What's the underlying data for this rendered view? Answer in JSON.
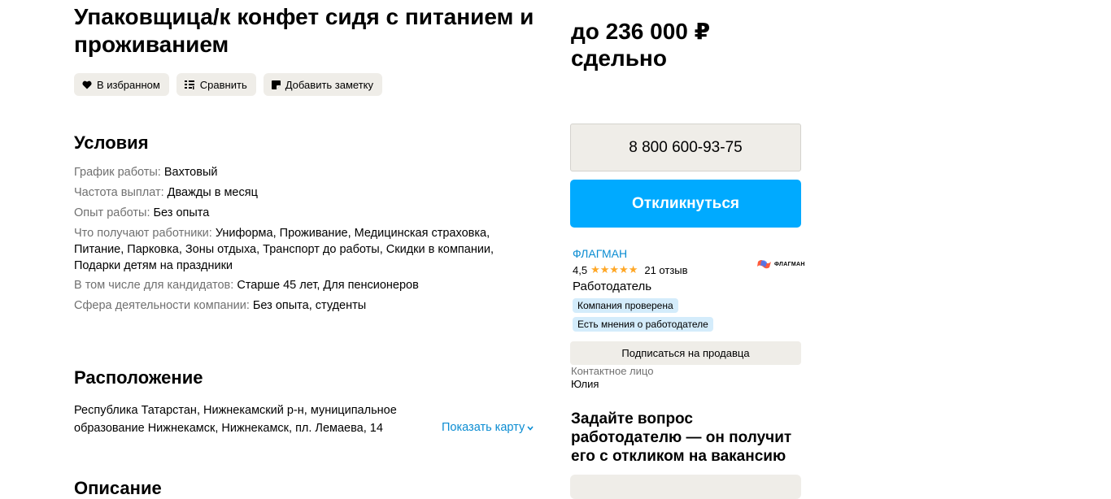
{
  "vacancy": {
    "title": "Упаковщица/к конфет сидя с питанием и проживанием",
    "actions": {
      "favorite": "В избранном",
      "compare": "Сравнить",
      "note": "Добавить заметку"
    }
  },
  "conditions": {
    "heading": "Условия",
    "rows": [
      {
        "label": "График работы:",
        "value": "Вахтовый"
      },
      {
        "label": "Частота выплат:",
        "value": "Дважды в месяц"
      },
      {
        "label": "Опыт работы:",
        "value": "Без опыта"
      },
      {
        "label": "Что получают работники:",
        "value": "Униформа, Проживание, Медицинская страховка, Питание, Парковка, Зоны отдыха, Транспорт до работы, Скидки в компании, Подарки детям на праздники"
      },
      {
        "label": "В том числе для кандидатов:",
        "value": "Старше 45 лет, Для пенсионеров"
      },
      {
        "label": "Сфера деятельности компании:",
        "value": "Без опыта, студенты"
      }
    ]
  },
  "location": {
    "heading": "Расположение",
    "address": "Республика Татарстан, Нижнекамский р-н, муниципальное образование Нижнекамск, Нижнекамск, пл. Лемаева, 14",
    "show_map": "Показать карту"
  },
  "description": {
    "heading": "Описание"
  },
  "sidebar": {
    "price_line1": "до 236 000 ₽",
    "price_line2": "сдельно",
    "phone": "8 800 600-93-75",
    "apply": "Откликнуться",
    "seller": {
      "name": "ФЛАГМАН",
      "rating": "4,5",
      "stars": "★★★★★",
      "reviews": "21 отзыв",
      "type": "Работодатель",
      "badges": [
        "Компания проверена",
        "Есть мнения о работодателе"
      ],
      "logo_text": "ФЛАГМАН"
    },
    "subscribe": "Подписаться на продавца",
    "contact_label": "Контактное лицо",
    "contact_name": "Юлия",
    "ask_heading": "Задайте вопрос работодателю — он получит его с откликом на вакансию"
  },
  "colors": {
    "accent": "#00aaff",
    "link": "#0a8cd2",
    "chip_bg": "#efede8",
    "badge_bg": "#d4ecfb",
    "star": "#ffa726"
  }
}
